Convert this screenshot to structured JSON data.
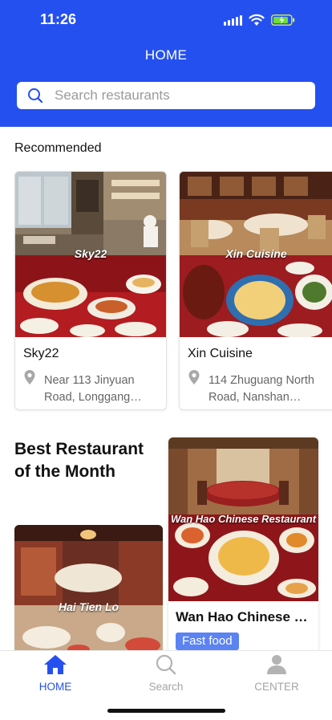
{
  "status": {
    "time": "11:26"
  },
  "header": {
    "title": "HOME",
    "search_placeholder": "Search restaurants"
  },
  "recommended": {
    "title": "Recommended",
    "items": [
      {
        "name": "Sky22",
        "address": "Near 113 Jinyuan Road, Longgang…",
        "image_caption": "Sky22"
      },
      {
        "name": "Xin Cuisine",
        "address": "114 Zhuguang North Road, Nanshan…",
        "image_caption": "Xin Cuisine"
      }
    ]
  },
  "best": {
    "title": "Best Restaurant of the Month",
    "left": {
      "image_caption": "Hai Tien Lo"
    },
    "right": {
      "name": "Wan Hao Chinese …",
      "image_caption": "Wan Hao Chinese Restaurant",
      "tag": "Fast food"
    }
  },
  "tabbar": {
    "items": [
      {
        "label": "HOME",
        "icon": "home-icon",
        "active": true
      },
      {
        "label": "Search",
        "icon": "search-icon",
        "active": false
      },
      {
        "label": "CENTER",
        "icon": "user-icon",
        "active": false
      }
    ]
  },
  "colors": {
    "primary": "#2450f0",
    "tag": "#5b83f2",
    "muted": "#a5a5a5"
  }
}
